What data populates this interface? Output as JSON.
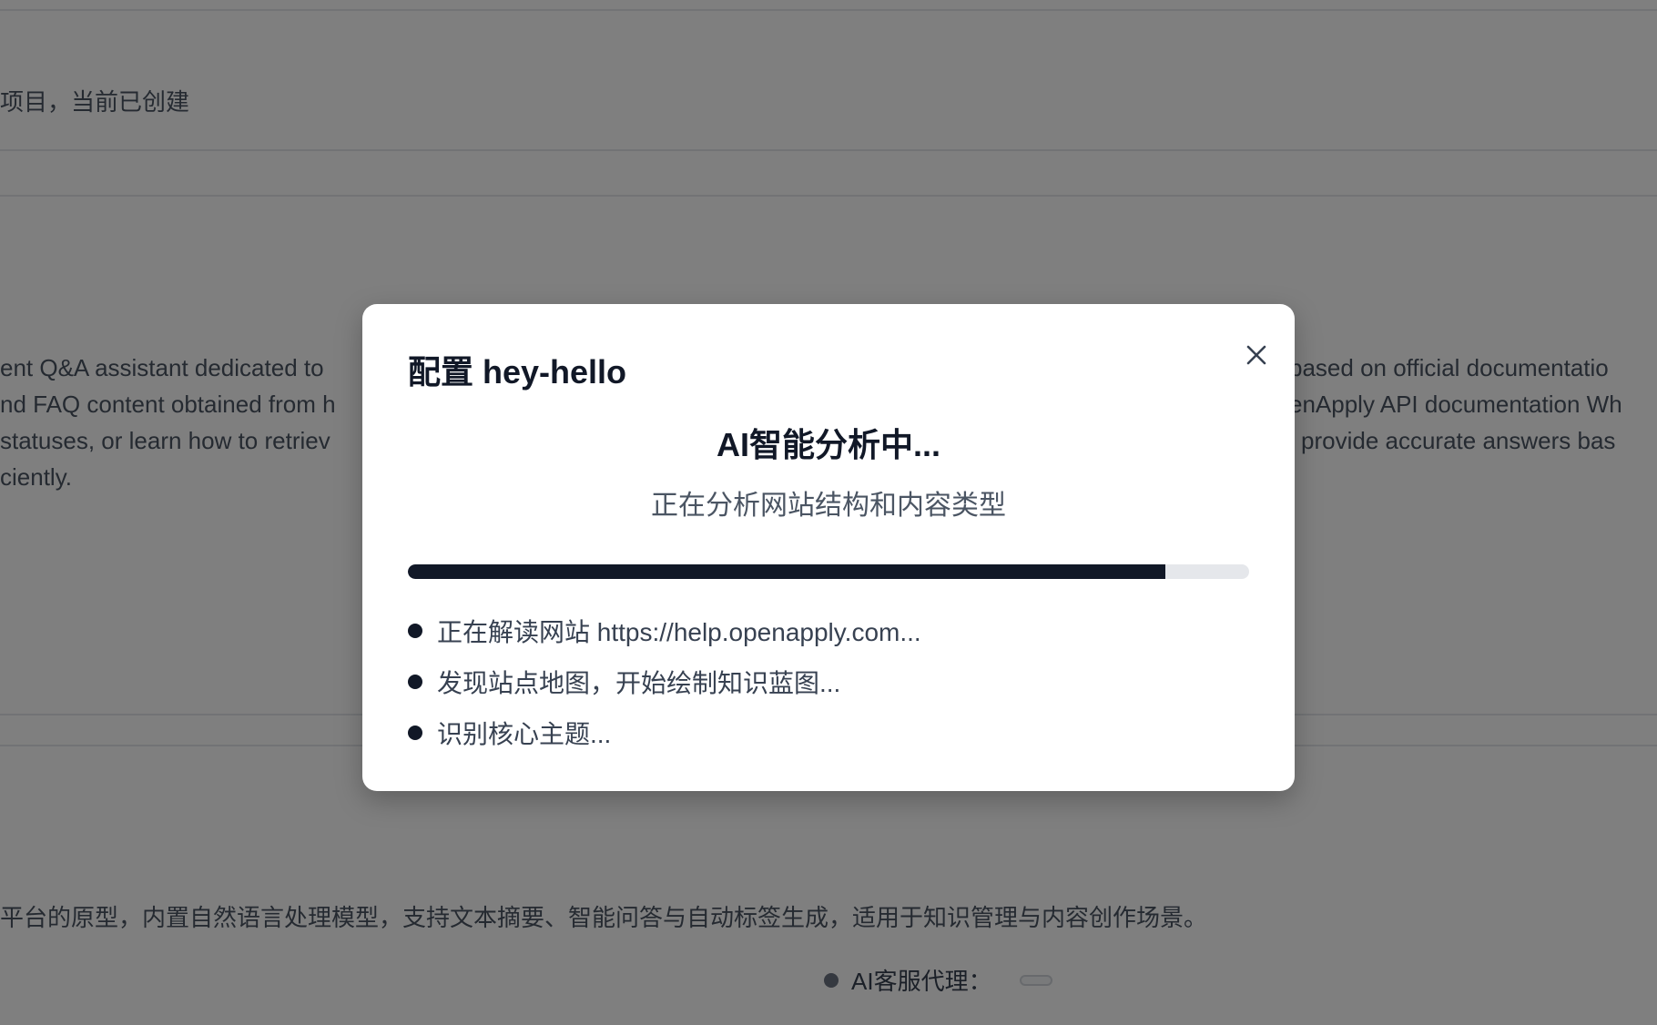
{
  "background": {
    "fragment_top": "项目，当前已创建",
    "description_left_lines": [
      "ent Q&A assistant dedicated to",
      "nd FAQ content obtained from h",
      "statuses, or learn how to retriev",
      "ciently."
    ],
    "description_right_lines": [
      "based on official documentatio",
      "enApply API documentation Wh",
      "l provide accurate answers bas"
    ],
    "description_bottom": "平台的原型，内置自然语言处理模型，支持文本摘要、智能问答与自动标签生成，适用于知识管理与内容创作场景。",
    "agent_label": "AI客服代理："
  },
  "modal": {
    "title": "配置 hey-hello",
    "heading": "AI智能分析中...",
    "subheading": "正在分析网站结构和内容类型",
    "progress_percent": 90,
    "steps": [
      {
        "label": "正在解读网站 https://help.openapply.com..."
      },
      {
        "label": "发现站点地图，开始绘制知识蓝图..."
      },
      {
        "label": "识别核心主题..."
      }
    ],
    "close_icon": "close-icon"
  },
  "colors": {
    "overlay": "rgba(0,0,0,0.5)",
    "progress_fill": "#111827",
    "progress_track": "#e5e7eb",
    "step_dot": "#111827"
  }
}
